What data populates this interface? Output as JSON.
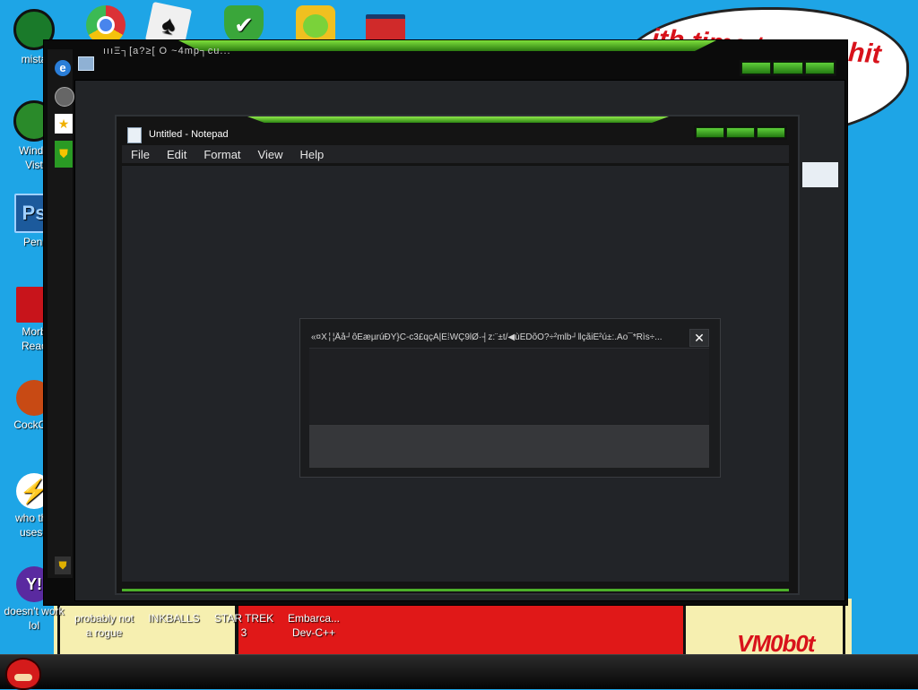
{
  "wallpaper": {
    "speech": "...ith time to eat shit\n...w",
    "signature": "VM0b0t"
  },
  "desktop_icons": [
    {
      "label": "mista",
      "icon": "green-orb-icon",
      "color": "#1a7a2a"
    },
    {
      "label": "Windo\nVist",
      "icon": "recycle-bin-icon",
      "color": "#2a8a2a"
    },
    {
      "label": "Peni",
      "icon": "photoshop-icon",
      "color": "#1c5a9c"
    },
    {
      "label": "Morb\nReac",
      "icon": "acrobat-reader-icon",
      "color": "#c8141b"
    },
    {
      "label": "CockClo",
      "icon": "ccleaner-icon",
      "color": "#c84a14"
    },
    {
      "label": "who the\nuses t",
      "icon": "flash-icon",
      "color": "#ec5a14"
    },
    {
      "label": "doesn't work\nlol",
      "icon": "yahoo-messenger-icon",
      "color": "#5a2aa0"
    },
    {
      "label": "probably not\na rogue",
      "icon": "shortcut-icon",
      "color": "#888888"
    },
    {
      "label": "INKBALLS",
      "icon": "inkball-icon",
      "color": "#888888"
    },
    {
      "label": "STAR TREK\n3",
      "icon": "star-trek-icon",
      "color": "#888888"
    },
    {
      "label": "Embarca...\nDev-C++",
      "icon": "devcpp-icon",
      "color": "#888888"
    }
  ],
  "top_icons": [
    {
      "icon": "chrome-icon",
      "color": "#e8e8e8"
    },
    {
      "icon": "solitaire-icon",
      "color": "#f0f0f0"
    },
    {
      "icon": "security-shield-icon",
      "color": "#3aa63a"
    },
    {
      "icon": "bad-piggies-icon",
      "color": "#f0c020"
    },
    {
      "icon": "winrar-logo-icon",
      "color": "#d02a2a"
    }
  ],
  "outer_window": {
    "title": "ıııΞ┐[a?≥[ O ~4mp┐cu..."
  },
  "notepad": {
    "title": "Untitled - Notepad",
    "menu": [
      "File",
      "Edit",
      "Format",
      "View",
      "Help"
    ]
  },
  "dialog": {
    "title": "«¤X╎¦Åå┘ôÈæµrúÐY}C-c3£qçÀ|Ê⁞WÇ9lØ·┤z:¨±t/◀ùÊDõO?÷²mlb┘‖çãiÊ²ú±:.Ao¯*Rìs÷...",
    "close": "✕"
  },
  "colors": {
    "desktop": "#1ea5e6",
    "accent_green": "#5fcf3a",
    "window_dark": "#141414"
  }
}
